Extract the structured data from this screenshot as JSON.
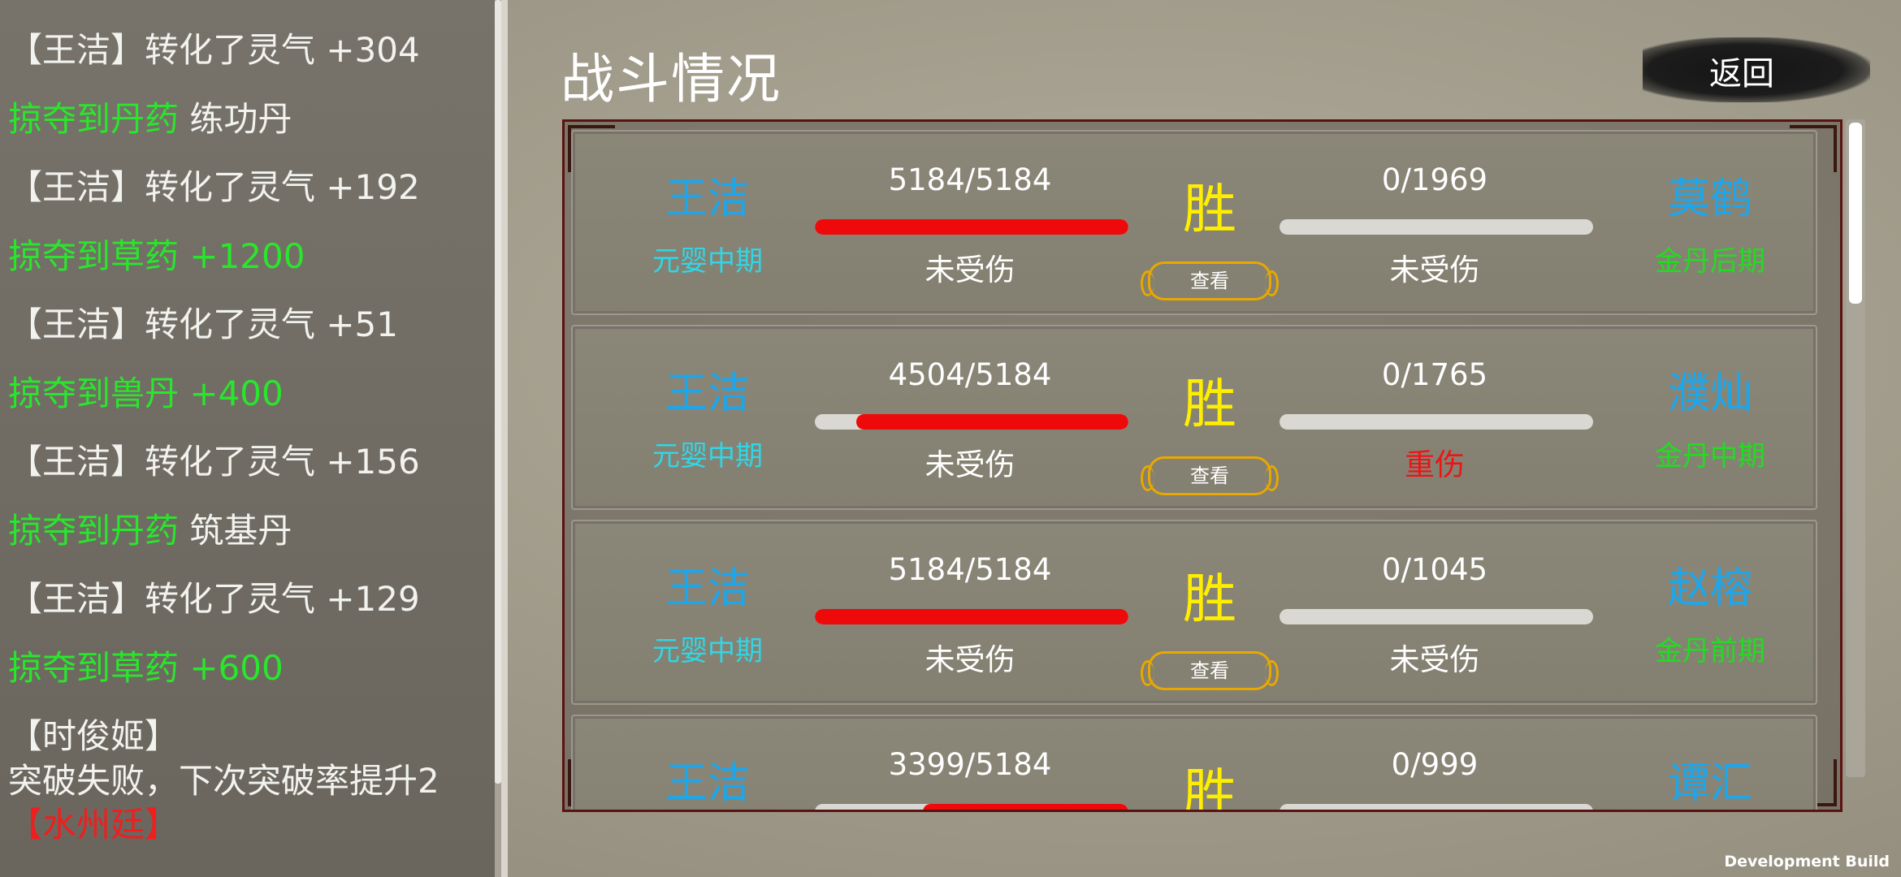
{
  "log": [
    {
      "parts": [
        {
          "t": "【王洁】转化了灵气 +304",
          "c": "white"
        }
      ]
    },
    {
      "parts": [
        {
          "t": "掠夺到丹药",
          "c": "green"
        },
        {
          "t": " 练功丹",
          "c": "white"
        }
      ]
    },
    {
      "parts": [
        {
          "t": "【王洁】转化了灵气 +192",
          "c": "white"
        }
      ]
    },
    {
      "parts": [
        {
          "t": "掠夺到草药 +1200",
          "c": "green"
        }
      ]
    },
    {
      "parts": [
        {
          "t": "【王洁】转化了灵气 +51",
          "c": "white"
        }
      ]
    },
    {
      "parts": [
        {
          "t": "掠夺到兽丹 +400",
          "c": "green"
        }
      ]
    },
    {
      "parts": [
        {
          "t": "【王洁】转化了灵气 +156",
          "c": "white"
        }
      ]
    },
    {
      "parts": [
        {
          "t": "掠夺到丹药",
          "c": "green"
        },
        {
          "t": " 筑基丹",
          "c": "white"
        }
      ]
    },
    {
      "parts": [
        {
          "t": "【王洁】转化了灵气 +129",
          "c": "white"
        }
      ]
    },
    {
      "parts": [
        {
          "t": "掠夺到草药 +600",
          "c": "green"
        }
      ]
    },
    {
      "parts": [
        {
          "t": "【时俊姬】",
          "c": "white"
        }
      ]
    },
    {
      "parts": [
        {
          "t": "突破失败，下次突破率提升2",
          "c": "white"
        }
      ]
    },
    {
      "parts": [
        {
          "t": "【水州廷】",
          "c": "red"
        }
      ]
    }
  ],
  "header": {
    "title": "战斗情况",
    "back_label": "返回"
  },
  "colors": {
    "accent_blue": "#1ea6ea",
    "win_yellow": "#ffee00",
    "hp_red": "#ee0a0a",
    "green": "#22dc22"
  },
  "battles": [
    {
      "left_name": "王洁",
      "left_realm": "元婴中期",
      "left_hp": "5184/5184",
      "left_hp_frac": 1.0,
      "left_status": "未受伤",
      "result": "胜",
      "view_label": "查看",
      "right_name": "莫鹤",
      "right_realm": "金丹后期",
      "right_hp": "0/1969",
      "right_hp_frac": 0,
      "right_status": "未受伤"
    },
    {
      "left_name": "王洁",
      "left_realm": "元婴中期",
      "left_hp": "4504/5184",
      "left_hp_frac": 0.869,
      "left_status": "未受伤",
      "result": "胜",
      "view_label": "查看",
      "right_name": "濮灿",
      "right_realm": "金丹中期",
      "right_hp": "0/1765",
      "right_hp_frac": 0,
      "right_status": "重伤"
    },
    {
      "left_name": "王洁",
      "left_realm": "元婴中期",
      "left_hp": "5184/5184",
      "left_hp_frac": 1.0,
      "left_status": "未受伤",
      "result": "胜",
      "view_label": "查看",
      "right_name": "赵榕",
      "right_realm": "金丹前期",
      "right_hp": "0/1045",
      "right_hp_frac": 0,
      "right_status": "未受伤"
    },
    {
      "left_name": "王洁",
      "left_realm": "",
      "left_hp": "3399/5184",
      "left_hp_frac": 0.656,
      "left_status": "",
      "result": "胜",
      "view_label": "",
      "right_name": "谭汇",
      "right_realm": "",
      "right_hp": "0/999",
      "right_hp_frac": 0,
      "right_status": ""
    }
  ],
  "footer": {
    "dev_label": "Development Build"
  }
}
